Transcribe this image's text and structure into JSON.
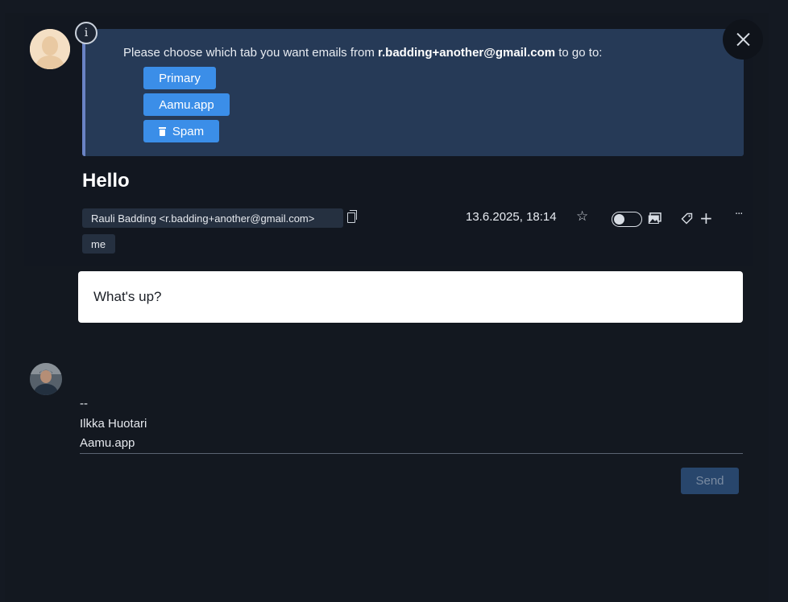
{
  "banner": {
    "text_prefix": "Please choose which tab you want emails from ",
    "text_email": "r.badding+another@gmail.com",
    "text_suffix": " to go to:",
    "buttons": [
      "Primary",
      "Aamu.app",
      "Spam"
    ]
  },
  "message": {
    "subject": "Hello",
    "from": "Rauli Badding <r.badding+another@gmail.com>",
    "to": "me",
    "date": "13.6.2025, 18:14",
    "body": "What's up?"
  },
  "reply": {
    "signature": [
      "--",
      "Ilkka Huotari",
      "Aamu.app"
    ],
    "send_label": "Send"
  },
  "icons": {
    "info": "info-icon",
    "close": "close-icon",
    "copy": "copy-icon",
    "star": "star-icon",
    "toggle": "toggle-switch",
    "images": "images-icon",
    "tag": "tag-icon",
    "plus": "plus-icon",
    "more": "more-icon",
    "trash": "trash-icon"
  },
  "colors": {
    "banner_bg": "#263a57",
    "accent_button": "#3b8ee8",
    "send_disabled": "#28466c"
  }
}
